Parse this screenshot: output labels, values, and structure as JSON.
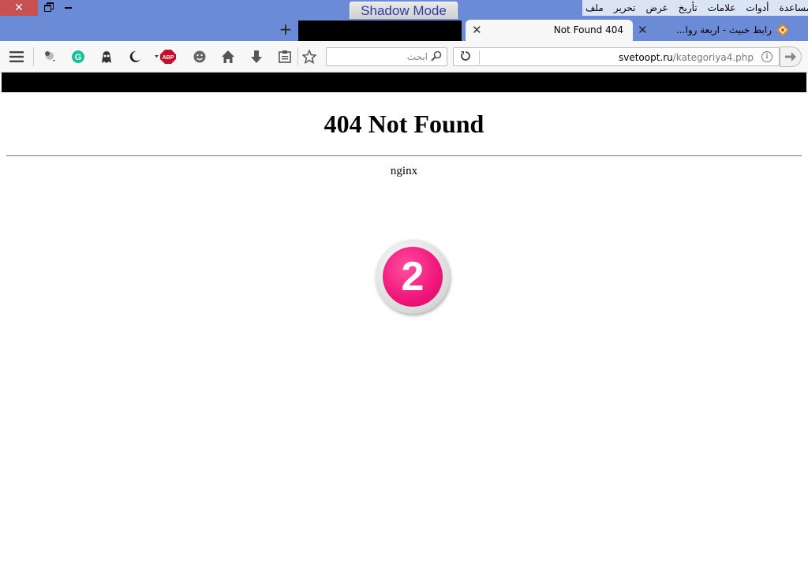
{
  "window": {
    "close_glyph": "✕",
    "shadow_mode_label": "Shadow Mode"
  },
  "menubar": {
    "items": [
      "ملف",
      "تحرير",
      "عرض",
      "تأريخ",
      "علامات",
      "أدوات",
      "مساعدة"
    ]
  },
  "tabs": {
    "new_tab_glyph": "+",
    "active": {
      "title": "Not Found 404",
      "close_glyph": "✕"
    },
    "inactive": {
      "title": "رابط خبيث - اربعة روا...",
      "close_glyph": "✕"
    }
  },
  "navbar": {
    "search_placeholder": "ابحث",
    "url_domain": "svetoopt.ru",
    "url_path": "/kategoriya4.php",
    "icons": [
      "menu-icon",
      "extension-icon",
      "grammarly-icon",
      "ghostery-icon",
      "night-mode-icon",
      "adblock-plus-icon",
      "emoji-icon",
      "home-icon",
      "download-icon",
      "reading-list-icon",
      "bookmark-star-icon",
      "search-icon",
      "reload-icon",
      "info-icon",
      "go-arrow-icon"
    ],
    "adblock_label": "ABP"
  },
  "page": {
    "heading": "404 Not Found",
    "server": "nginx",
    "badge_number": "2"
  },
  "colors": {
    "titlebar": "#6b8bd6",
    "close_button": "#c75050",
    "badge_pink": "#f0167a"
  }
}
